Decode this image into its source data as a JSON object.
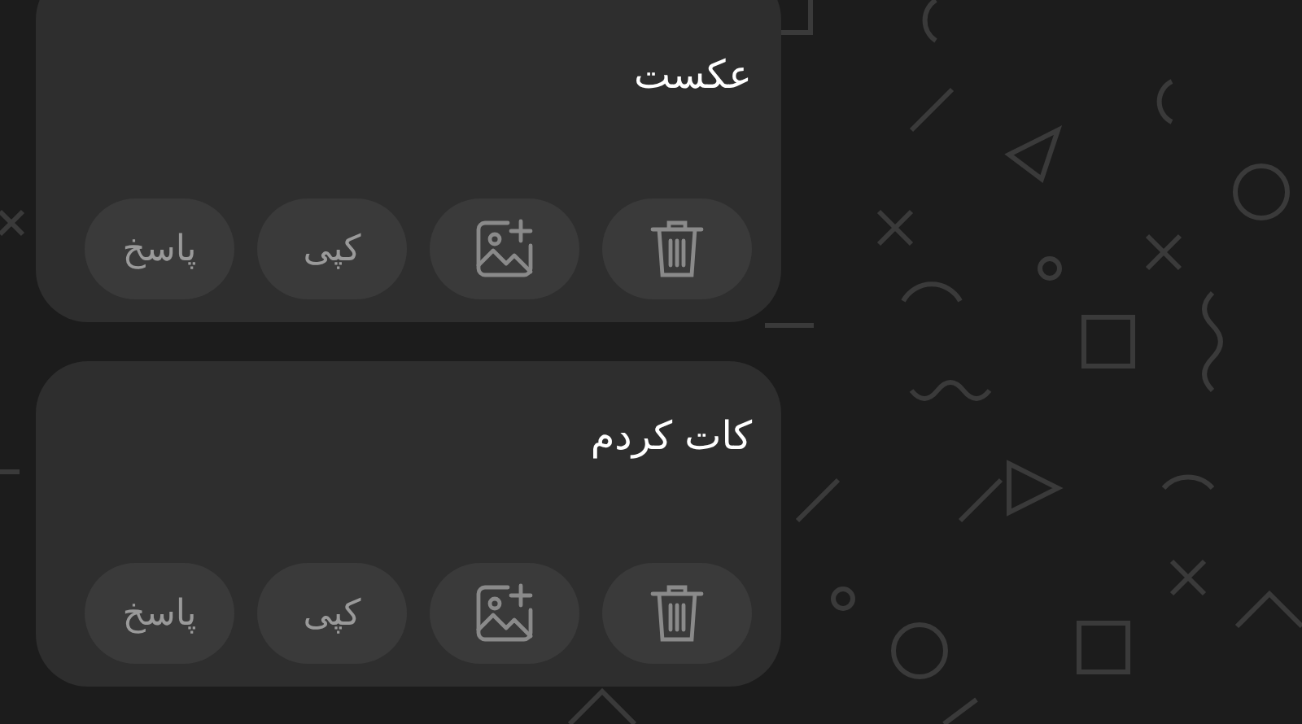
{
  "messages": [
    {
      "text": "عکست",
      "actions": [
        {
          "kind": "delete"
        },
        {
          "kind": "add-image"
        },
        {
          "kind": "text",
          "label": "کپی"
        },
        {
          "kind": "text",
          "label": "پاسخ"
        }
      ]
    },
    {
      "text": "کات کردم",
      "actions": [
        {
          "kind": "delete"
        },
        {
          "kind": "add-image"
        },
        {
          "kind": "text",
          "label": "کپی"
        },
        {
          "kind": "text",
          "label": "پاسخ"
        }
      ]
    }
  ]
}
